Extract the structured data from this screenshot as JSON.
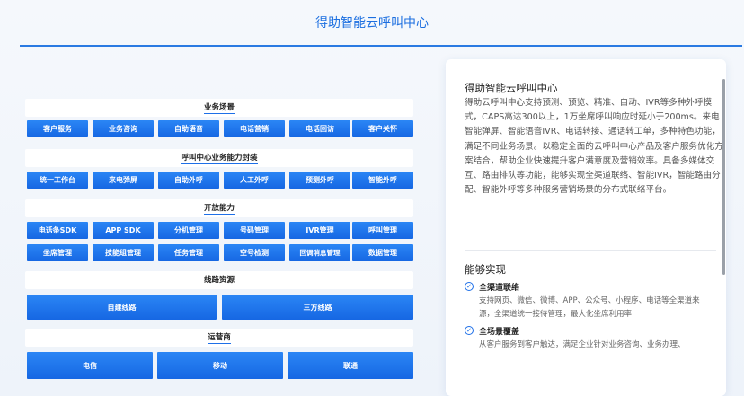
{
  "header": {
    "title": "得助智能云呼叫中心"
  },
  "diagram": {
    "sections": [
      {
        "title": "业务场景",
        "buttons": [
          "客户服务",
          "业务咨询",
          "自助语音",
          "电话营销",
          "电话回访",
          "客户关怀"
        ]
      },
      {
        "title": "呼叫中心业务能力封装",
        "buttons": [
          "统一工作台",
          "来电弹屏",
          "自助外呼",
          "人工外呼",
          "预测外呼",
          "智能外呼"
        ]
      },
      {
        "title": "开放能力",
        "row1": [
          "电话条SDK",
          "APP SDK",
          "分机管理",
          "号码管理",
          "IVR管理",
          "呼叫管理"
        ],
        "row2": [
          "坐席管理",
          "技能组管理",
          "任务管理",
          "空号检测",
          "回调消息管理",
          "数据管理"
        ]
      },
      {
        "title": "线路资源",
        "buttons": [
          "自建线路",
          "三方线路"
        ]
      },
      {
        "title": "运营商",
        "buttons": [
          "电信",
          "移动",
          "联通"
        ]
      }
    ]
  },
  "panel": {
    "title": "得助智能云呼叫中心",
    "description": "得助云呼叫中心支持预测、预览、精准、自动、IVR等多种外呼模式，CAPS高达300以上，1万坐席呼叫响应时延小于200ms。来电智能弹屏、智能语音IVR、电话转接、通话转工单，多种特色功能，满足不同业务场景。以稳定全面的云呼叫中心产品及客户服务优化方案结合，帮助企业快速提升客户满意度及营销效率。具备多媒体交互、路由排队等功能，能够实现全渠道联络、智能IVR，智能路由分配、智能外呼等多种服务营销场景的分布式联络平台。",
    "subtitle": "能够实现",
    "features": [
      {
        "title": "全渠道联络",
        "desc": "支持网页、微信、微博、APP、公众号、小程序、电话等全渠道来源，全渠道统一接待管理，最大化坐席利用率"
      },
      {
        "title": "全场景覆盖",
        "desc": "从客户服务到客户触达，满足企业针对业务咨询、业务办理、"
      }
    ]
  },
  "colors": {
    "accent": "#1d6fe8",
    "button": "#1a6fe6",
    "background": "#f2f6fb"
  },
  "icons": {
    "feature": "check-circle-icon"
  }
}
